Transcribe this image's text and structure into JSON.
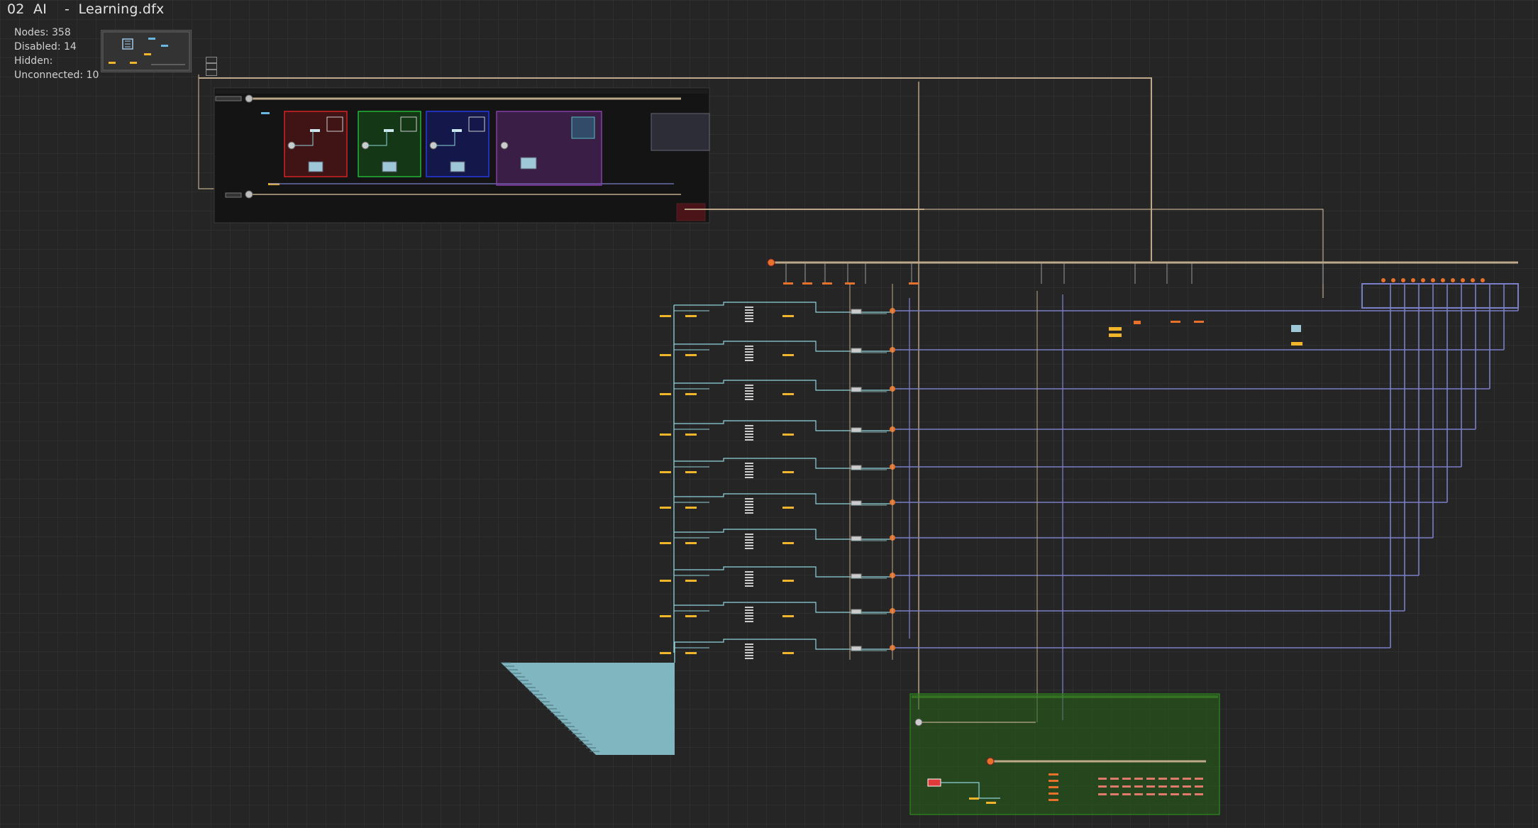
{
  "window": {
    "title": "02  AI    -  Learning.dfx"
  },
  "stats": [
    {
      "label": "Nodes:",
      "value": "358"
    },
    {
      "label": "Disabled:",
      "value": "14"
    },
    {
      "label": "Hidden:",
      "value": ""
    },
    {
      "label": "Unconnected:",
      "value": "10"
    }
  ],
  "colors": {
    "background": "#252525",
    "grid": "#2e2e2e",
    "wire_main": "#bda98a",
    "wire_blue": "#7a7ec8",
    "wire_cyan": "#8fd3dc",
    "node_orange": "#e7702a",
    "node_yellow": "#f0b52b",
    "group_red": "#e02424",
    "group_green": "#24c03a",
    "group_blue": "#2a3cf0",
    "group_purple": "#8b3fb0",
    "group_dark_green": "#2f6b1c"
  },
  "icons": [
    "minimap-icon",
    "node-port-icon",
    "junction-icon",
    "zoom-toggle-icon"
  ]
}
